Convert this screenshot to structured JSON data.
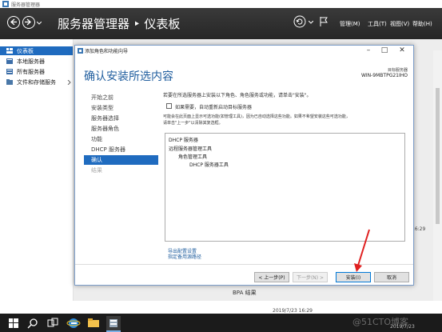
{
  "server_manager": {
    "window_title": "服务器管理器",
    "header_title": "服务器管理器 ‣ 仪表板",
    "menu": {
      "manage": "管理(M)",
      "tools": "工具(T)",
      "view": "视图(V)",
      "help": "帮助(H)"
    },
    "sidebar": [
      {
        "label": "仪表板",
        "icon": "dashboard-icon",
        "active": true
      },
      {
        "label": "本地服务器",
        "icon": "server-icon",
        "active": false
      },
      {
        "label": "所有服务器",
        "icon": "servers-icon",
        "active": false
      },
      {
        "label": "文件和存储服务",
        "icon": "storage-icon",
        "active": false
      }
    ],
    "background": {
      "bpa_label": "BPA 结果",
      "bpa_time": "2019/7/23 16:29",
      "time2": "16:29",
      "date2": "1"
    }
  },
  "wizard": {
    "window_title": "添加角色和功能向导",
    "heading": "确认安装所选内容",
    "target_label": "目标服务器",
    "target_server": "WIN-9MBTPG21IHO",
    "steps": [
      {
        "label": "开始之前",
        "state": "normal"
      },
      {
        "label": "安装类型",
        "state": "normal"
      },
      {
        "label": "服务器选择",
        "state": "normal"
      },
      {
        "label": "服务器角色",
        "state": "normal"
      },
      {
        "label": "功能",
        "state": "normal"
      },
      {
        "label": "DHCP 服务器",
        "state": "normal"
      },
      {
        "label": "确认",
        "state": "active"
      },
      {
        "label": "结果",
        "state": "disabled"
      }
    ],
    "intro": "若要在所选服务器上安装以下角色、角色服务或功能，请单击\"安装\"。",
    "restart_label": "如果需要，自动重新启动目标服务器",
    "restart_checked": false,
    "note_line1": "可能会在此页面上显示可选功能(如管理工具)，因为已自动选择这些功能。如果不希望安装这些可选功能，",
    "note_line2": "请单击\"上一步\"以清除其复选框。",
    "items": [
      {
        "label": "DHCP 服务器",
        "level": 0
      },
      {
        "label": "远程服务器管理工具",
        "level": 0
      },
      {
        "label": "角色管理工具",
        "level": 1
      },
      {
        "label": "DHCP 服务器工具",
        "level": 2
      }
    ],
    "export_link": "导出配置设置",
    "alt_source_link": "指定备用源路径",
    "buttons": {
      "prev": "< 上一步(P)",
      "next": "下一步(N) >",
      "install": "安装(I)",
      "cancel": "取消"
    }
  },
  "taskbar": {
    "watermark": "@51CTO博客",
    "date": "2019/7/23"
  },
  "colors": {
    "accent": "#1f6bbf",
    "header_bg": "#2f2f2f",
    "heading_blue": "#1f5d9e",
    "arrow": "#e02020",
    "taskbar_bg": "#1b1b1b"
  }
}
